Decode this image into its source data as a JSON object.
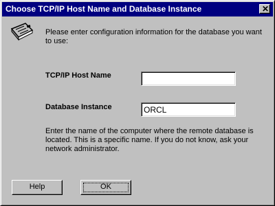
{
  "window": {
    "title": "Choose TCP/IP Host Name and Database Instance",
    "close_icon": "close-icon"
  },
  "intro": {
    "icon": "network-card-icon",
    "text": "Please enter configuration information for the database you want to use:"
  },
  "form": {
    "host_label": "TCP/IP Host Name",
    "host_value": "",
    "db_label": "Database Instance",
    "db_value": "ORCL"
  },
  "help_text": "Enter the name of the computer where the remote database is located.  This is a specific name.  If you do not know, ask your network administrator.",
  "buttons": {
    "help": "Help",
    "ok": "OK"
  }
}
